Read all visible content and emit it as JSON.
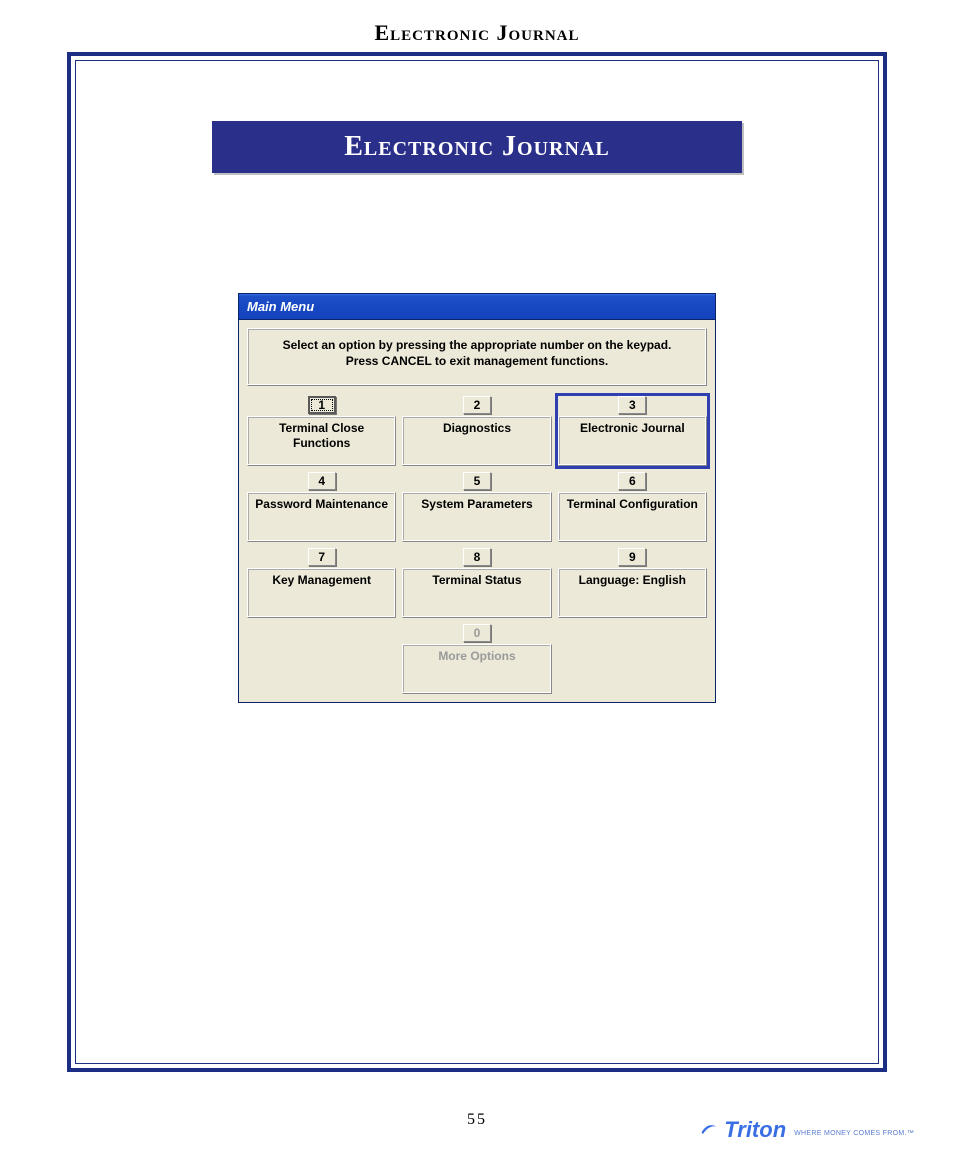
{
  "page": {
    "header": "Electronic Journal",
    "title_banner": "Electronic Journal",
    "page_number": "55",
    "footer_brand": "Triton",
    "footer_tagline": "WHERE MONEY COMES FROM.™"
  },
  "window": {
    "title": "Main Menu",
    "instruction_line1": "Select an option by pressing the appropriate number on the keypad.",
    "instruction_line2": "Press CANCEL to exit management functions.",
    "options": [
      {
        "num": "1",
        "label": "Terminal Close Functions",
        "selected": true,
        "highlighted": false,
        "disabled": false
      },
      {
        "num": "2",
        "label": "Diagnostics",
        "selected": false,
        "highlighted": false,
        "disabled": false
      },
      {
        "num": "3",
        "label": "Electronic Journal",
        "selected": false,
        "highlighted": true,
        "disabled": false
      },
      {
        "num": "4",
        "label": "Password Maintenance",
        "selected": false,
        "highlighted": false,
        "disabled": false
      },
      {
        "num": "5",
        "label": "System Parameters",
        "selected": false,
        "highlighted": false,
        "disabled": false
      },
      {
        "num": "6",
        "label": "Terminal Configuration",
        "selected": false,
        "highlighted": false,
        "disabled": false
      },
      {
        "num": "7",
        "label": "Key Management",
        "selected": false,
        "highlighted": false,
        "disabled": false
      },
      {
        "num": "8",
        "label": "Terminal Status",
        "selected": false,
        "highlighted": false,
        "disabled": false
      },
      {
        "num": "9",
        "label": "Language: English",
        "selected": false,
        "highlighted": false,
        "disabled": false
      }
    ],
    "zero_option": {
      "num": "0",
      "label": "More Options",
      "disabled": true
    }
  }
}
